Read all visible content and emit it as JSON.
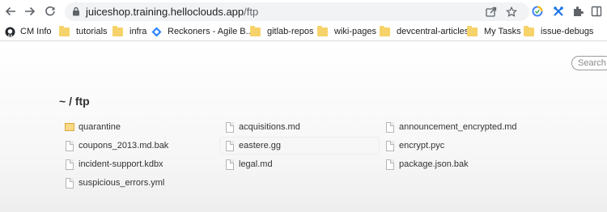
{
  "browser": {
    "url_host": "juiceshop.training.helloclouds.app",
    "url_path": "/ftp"
  },
  "bookmarks": [
    {
      "label": "CM Info",
      "icon": "github-icon"
    },
    {
      "label": "tutorials",
      "icon": "folder-icon"
    },
    {
      "label": "infra",
      "icon": "folder-icon"
    },
    {
      "label": "Reckoners - Agile B...",
      "icon": "diamond-icon"
    },
    {
      "label": "gitlab-repos",
      "icon": "folder-icon"
    },
    {
      "label": "wiki-pages",
      "icon": "folder-icon"
    },
    {
      "label": "devcentral-articles",
      "icon": "folder-icon"
    },
    {
      "label": "My Tasks",
      "icon": "folder-icon"
    },
    {
      "label": "issue-debugs",
      "icon": "folder-icon"
    }
  ],
  "listing": {
    "search_placeholder": "Search",
    "title": "~ / ftp",
    "items": [
      {
        "name": "quarantine",
        "type": "folder"
      },
      {
        "name": "acquisitions.md",
        "type": "file"
      },
      {
        "name": "announcement_encrypted.md",
        "type": "file"
      },
      {
        "name": "coupons_2013.md.bak",
        "type": "file"
      },
      {
        "name": "eastere.gg",
        "type": "file"
      },
      {
        "name": "encrypt.pyc",
        "type": "file"
      },
      {
        "name": "incident-support.kdbx",
        "type": "file"
      },
      {
        "name": "legal.md",
        "type": "file"
      },
      {
        "name": "package.json.bak",
        "type": "file"
      },
      {
        "name": "suspicious_errors.yml",
        "type": "file"
      }
    ]
  }
}
